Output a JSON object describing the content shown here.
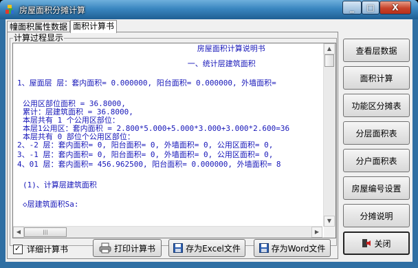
{
  "window": {
    "title": "房屋面积分摊计算",
    "minimize_glyph": "_",
    "maximize_glyph": "□",
    "close_glyph": "X"
  },
  "tabs": [
    {
      "label": "幢面积属性数据",
      "active": false
    },
    {
      "label": "面积计算书",
      "active": true
    }
  ],
  "group": {
    "label": "计算过程显示"
  },
  "report_lines": [
    "      房屋面积计算说明书",
    "      一、统计层建筑面积",
    "1、屋面层 层：套内面积= 0.000000, 阳台面积= 0.000000, 外墙面积=",
    "",
    "公用区部位面积 = 36.8000,",
    "累计：层建筑面积 = 36.8000,",
    "本层共有 1 个公用区部位：",
    "本层1公用区：套内面积 = 2.800*5.000+5.000*3.000+3.000*2.600=36",
    "本层共有 0 部位个公用区部位：",
    "2、-2 层：套内面积= 0, 阳台面积= 0, 外墙面积= 0, 公用区面积= 0,",
    "3、-1 层：套内面积= 0, 阳台面积= 0, 外墙面积= 0, 公用区面积= 0,",
    "4、01 层：套内面积= 456.962500, 阳台面积= 0.000000, 外墙面积= 8",
    "",
    "(1)、计算层建筑面积",
    "",
    "◇层建筑面积Sa:"
  ],
  "options": {
    "detail_label": "详细计算书",
    "detail_checked": true
  },
  "bottom_buttons": {
    "print": "打印计算书",
    "excel": "存为Excel文件",
    "word": "存为Word文件"
  },
  "side_buttons": [
    "查看层数据",
    "面积计算",
    "功能区分摊表",
    "分层面积表",
    "分户面积表",
    "房屋编号设置",
    "分摊说明"
  ],
  "close_button": "关闭",
  "colors": {
    "report_text": "#1515b8",
    "title_bar": "#3a86c0"
  }
}
